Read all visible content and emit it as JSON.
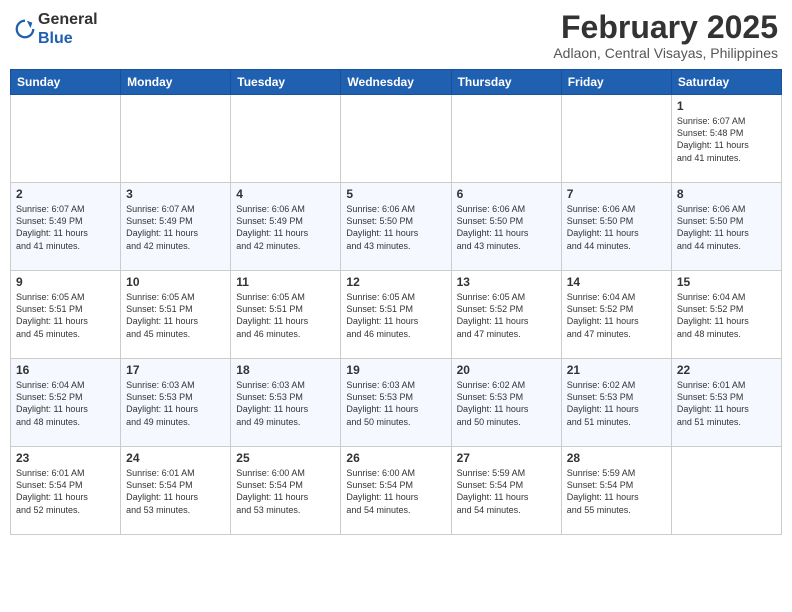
{
  "header": {
    "logo_general": "General",
    "logo_blue": "Blue",
    "month_year": "February 2025",
    "location": "Adlaon, Central Visayas, Philippines"
  },
  "weekdays": [
    "Sunday",
    "Monday",
    "Tuesday",
    "Wednesday",
    "Thursday",
    "Friday",
    "Saturday"
  ],
  "weeks": [
    [
      {
        "day": "",
        "info": ""
      },
      {
        "day": "",
        "info": ""
      },
      {
        "day": "",
        "info": ""
      },
      {
        "day": "",
        "info": ""
      },
      {
        "day": "",
        "info": ""
      },
      {
        "day": "",
        "info": ""
      },
      {
        "day": "1",
        "info": "Sunrise: 6:07 AM\nSunset: 5:48 PM\nDaylight: 11 hours\nand 41 minutes."
      }
    ],
    [
      {
        "day": "2",
        "info": "Sunrise: 6:07 AM\nSunset: 5:49 PM\nDaylight: 11 hours\nand 41 minutes."
      },
      {
        "day": "3",
        "info": "Sunrise: 6:07 AM\nSunset: 5:49 PM\nDaylight: 11 hours\nand 42 minutes."
      },
      {
        "day": "4",
        "info": "Sunrise: 6:06 AM\nSunset: 5:49 PM\nDaylight: 11 hours\nand 42 minutes."
      },
      {
        "day": "5",
        "info": "Sunrise: 6:06 AM\nSunset: 5:50 PM\nDaylight: 11 hours\nand 43 minutes."
      },
      {
        "day": "6",
        "info": "Sunrise: 6:06 AM\nSunset: 5:50 PM\nDaylight: 11 hours\nand 43 minutes."
      },
      {
        "day": "7",
        "info": "Sunrise: 6:06 AM\nSunset: 5:50 PM\nDaylight: 11 hours\nand 44 minutes."
      },
      {
        "day": "8",
        "info": "Sunrise: 6:06 AM\nSunset: 5:50 PM\nDaylight: 11 hours\nand 44 minutes."
      }
    ],
    [
      {
        "day": "9",
        "info": "Sunrise: 6:05 AM\nSunset: 5:51 PM\nDaylight: 11 hours\nand 45 minutes."
      },
      {
        "day": "10",
        "info": "Sunrise: 6:05 AM\nSunset: 5:51 PM\nDaylight: 11 hours\nand 45 minutes."
      },
      {
        "day": "11",
        "info": "Sunrise: 6:05 AM\nSunset: 5:51 PM\nDaylight: 11 hours\nand 46 minutes."
      },
      {
        "day": "12",
        "info": "Sunrise: 6:05 AM\nSunset: 5:51 PM\nDaylight: 11 hours\nand 46 minutes."
      },
      {
        "day": "13",
        "info": "Sunrise: 6:05 AM\nSunset: 5:52 PM\nDaylight: 11 hours\nand 47 minutes."
      },
      {
        "day": "14",
        "info": "Sunrise: 6:04 AM\nSunset: 5:52 PM\nDaylight: 11 hours\nand 47 minutes."
      },
      {
        "day": "15",
        "info": "Sunrise: 6:04 AM\nSunset: 5:52 PM\nDaylight: 11 hours\nand 48 minutes."
      }
    ],
    [
      {
        "day": "16",
        "info": "Sunrise: 6:04 AM\nSunset: 5:52 PM\nDaylight: 11 hours\nand 48 minutes."
      },
      {
        "day": "17",
        "info": "Sunrise: 6:03 AM\nSunset: 5:53 PM\nDaylight: 11 hours\nand 49 minutes."
      },
      {
        "day": "18",
        "info": "Sunrise: 6:03 AM\nSunset: 5:53 PM\nDaylight: 11 hours\nand 49 minutes."
      },
      {
        "day": "19",
        "info": "Sunrise: 6:03 AM\nSunset: 5:53 PM\nDaylight: 11 hours\nand 50 minutes."
      },
      {
        "day": "20",
        "info": "Sunrise: 6:02 AM\nSunset: 5:53 PM\nDaylight: 11 hours\nand 50 minutes."
      },
      {
        "day": "21",
        "info": "Sunrise: 6:02 AM\nSunset: 5:53 PM\nDaylight: 11 hours\nand 51 minutes."
      },
      {
        "day": "22",
        "info": "Sunrise: 6:01 AM\nSunset: 5:53 PM\nDaylight: 11 hours\nand 51 minutes."
      }
    ],
    [
      {
        "day": "23",
        "info": "Sunrise: 6:01 AM\nSunset: 5:54 PM\nDaylight: 11 hours\nand 52 minutes."
      },
      {
        "day": "24",
        "info": "Sunrise: 6:01 AM\nSunset: 5:54 PM\nDaylight: 11 hours\nand 53 minutes."
      },
      {
        "day": "25",
        "info": "Sunrise: 6:00 AM\nSunset: 5:54 PM\nDaylight: 11 hours\nand 53 minutes."
      },
      {
        "day": "26",
        "info": "Sunrise: 6:00 AM\nSunset: 5:54 PM\nDaylight: 11 hours\nand 54 minutes."
      },
      {
        "day": "27",
        "info": "Sunrise: 5:59 AM\nSunset: 5:54 PM\nDaylight: 11 hours\nand 54 minutes."
      },
      {
        "day": "28",
        "info": "Sunrise: 5:59 AM\nSunset: 5:54 PM\nDaylight: 11 hours\nand 55 minutes."
      },
      {
        "day": "",
        "info": ""
      }
    ]
  ]
}
